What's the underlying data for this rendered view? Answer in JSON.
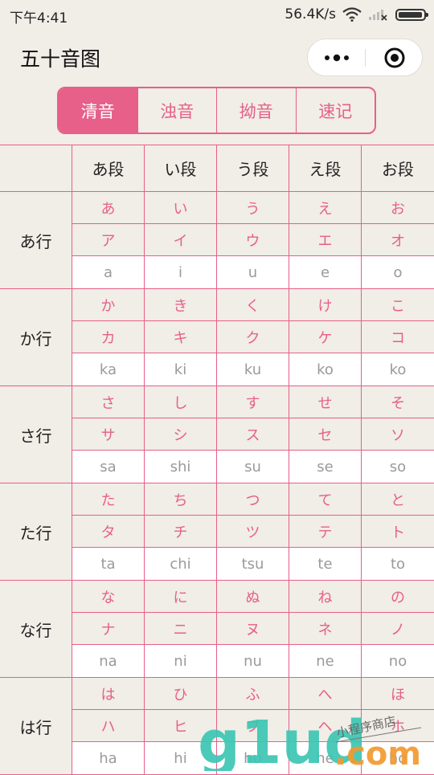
{
  "status": {
    "time": "下午4:41",
    "speed": "56.4K/s"
  },
  "title": "五十音图",
  "tabs": [
    {
      "label": "清音",
      "active": true
    },
    {
      "label": "浊音"
    },
    {
      "label": "拗音"
    },
    {
      "label": "速记"
    }
  ],
  "columns": [
    "あ段",
    "い段",
    "う段",
    "え段",
    "お段"
  ],
  "rows": [
    {
      "label": "あ行",
      "hira": [
        "あ",
        "い",
        "う",
        "え",
        "お"
      ],
      "kata": [
        "ア",
        "イ",
        "ウ",
        "エ",
        "オ"
      ],
      "roma": [
        "a",
        "i",
        "u",
        "e",
        "o"
      ]
    },
    {
      "label": "か行",
      "hira": [
        "か",
        "き",
        "く",
        "け",
        "こ"
      ],
      "kata": [
        "カ",
        "キ",
        "ク",
        "ケ",
        "コ"
      ],
      "roma": [
        "ka",
        "ki",
        "ku",
        "ko",
        "ko"
      ]
    },
    {
      "label": "さ行",
      "hira": [
        "さ",
        "し",
        "す",
        "せ",
        "そ"
      ],
      "kata": [
        "サ",
        "シ",
        "ス",
        "セ",
        "ソ"
      ],
      "roma": [
        "sa",
        "shi",
        "su",
        "se",
        "so"
      ]
    },
    {
      "label": "た行",
      "hira": [
        "た",
        "ち",
        "つ",
        "て",
        "と"
      ],
      "kata": [
        "タ",
        "チ",
        "ツ",
        "テ",
        "ト"
      ],
      "roma": [
        "ta",
        "chi",
        "tsu",
        "te",
        "to"
      ]
    },
    {
      "label": "な行",
      "hira": [
        "な",
        "に",
        "ぬ",
        "ね",
        "の"
      ],
      "kata": [
        "ナ",
        "ニ",
        "ヌ",
        "ネ",
        "ノ"
      ],
      "roma": [
        "na",
        "ni",
        "nu",
        "ne",
        "no"
      ]
    },
    {
      "label": "は行",
      "hira": [
        "は",
        "ひ",
        "ふ",
        "へ",
        "ほ"
      ],
      "kata": [
        "ハ",
        "ヒ",
        "フ",
        "ヘ",
        "ホ"
      ],
      "roma": [
        "ha",
        "hi",
        "hu",
        "he",
        "ho"
      ]
    }
  ],
  "watermark": {
    "brand": "g1ud",
    "tld": ".com",
    "tagline": "小程序商店"
  },
  "colors": {
    "accent": "#e6608a",
    "background": "#f1ede7"
  }
}
